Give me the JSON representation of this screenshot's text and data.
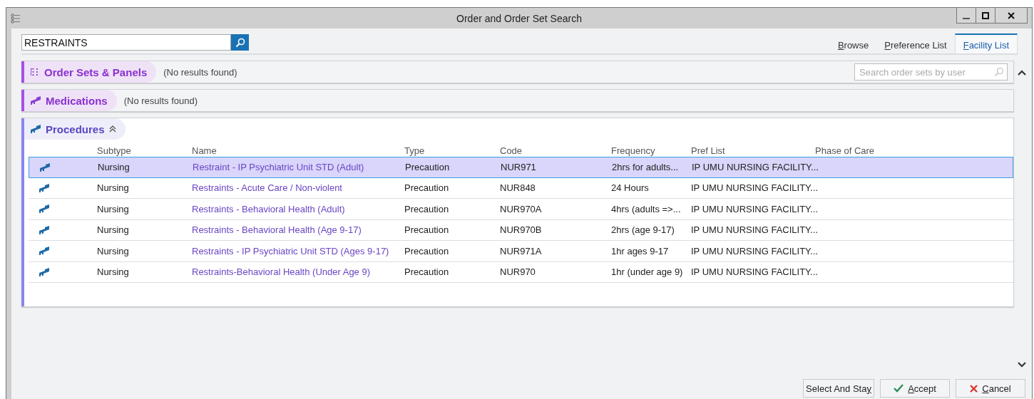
{
  "window": {
    "title": "Order and Order Set Search"
  },
  "search": {
    "value": "RESTRAINTS"
  },
  "tabs": [
    {
      "key": "B",
      "post": "rowse",
      "selected": false
    },
    {
      "key": "P",
      "post": "reference List",
      "selected": false
    },
    {
      "key": "F",
      "post": "acility List",
      "selected": true
    }
  ],
  "sections": [
    {
      "kind": "order-set",
      "title": "Order Sets & Panels",
      "color": "#a64ee6",
      "status": "(No results found)",
      "user_search": {
        "placeholder": "Search order sets by user"
      }
    },
    {
      "kind": "order",
      "title": "Medications",
      "color": "#a64ee6",
      "status": "(No results found)"
    },
    {
      "kind": "order",
      "title": "Procedures",
      "color": "#8c84f0",
      "expanded": true,
      "table": {
        "columns": [
          "Subtype",
          "Name",
          "Type",
          "Code",
          "Frequency",
          "Pref List",
          "Phase of Care"
        ],
        "rows": [
          {
            "selected": true,
            "cells": [
              "Nursing",
              "Restraint - IP Psychiatric Unit STD (Adult)",
              "Precaution",
              "NUR971",
              "2hrs for adults...",
              "IP UMU NURSING FACILITY..."
            ]
          },
          {
            "selected": false,
            "cells": [
              "Nursing",
              "Restraints - Acute Care / Non-violent",
              "Precaution",
              "NUR848",
              "24 Hours",
              "IP UMU NURSING FACILITY..."
            ]
          },
          {
            "selected": false,
            "cells": [
              "Nursing",
              "Restraints - Behavioral Health (Adult)",
              "Precaution",
              "NUR970A",
              "4hrs (adults =>...",
              "IP UMU NURSING FACILITY..."
            ]
          },
          {
            "selected": false,
            "cells": [
              "Nursing",
              "Restraints - Behavioral Health (Age 9-17)",
              "Precaution",
              "NUR970B",
              "2hrs (age 9-17)",
              "IP UMU NURSING FACILITY..."
            ]
          },
          {
            "selected": false,
            "cells": [
              "Nursing",
              "Restraints - IP Psychiatric Unit STD (Ages 9-17)",
              "Precaution",
              "NUR971A",
              "1hr ages 9-17",
              "IP UMU NURSING FACILITY..."
            ]
          },
          {
            "selected": false,
            "cells": [
              "Nursing",
              "Restraints-Behavioral Health (Under Age 9)",
              "Precaution",
              "NUR970",
              "1hr (under age 9)",
              "IP UMU NURSING FACILITY..."
            ]
          }
        ]
      }
    }
  ],
  "buttons": [
    {
      "kind": "plain",
      "pre": "Select And Sta",
      "key": "y"
    },
    {
      "kind": "accept",
      "key": "A",
      "post": "ccept"
    },
    {
      "kind": "cancel",
      "key": "C",
      "post": "ancel"
    }
  ]
}
